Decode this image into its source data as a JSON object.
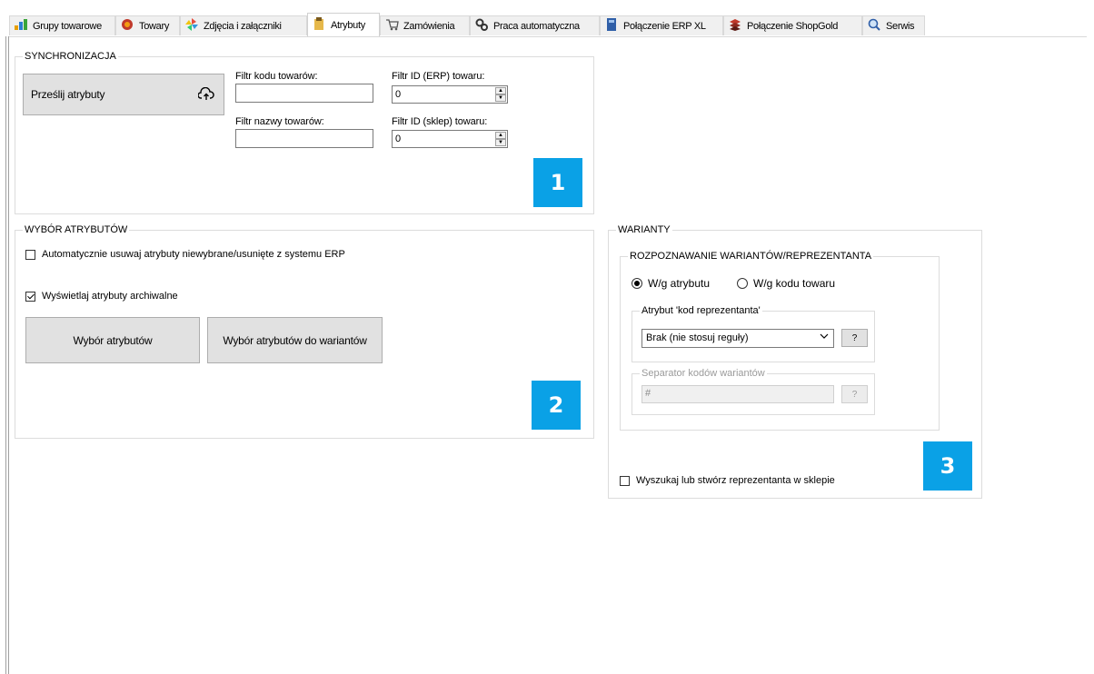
{
  "tabs": [
    {
      "label": "Grupy towarowe",
      "icon": "group-icon"
    },
    {
      "label": "Towary",
      "icon": "products-icon"
    },
    {
      "label": "Zdjęcia i załączniki",
      "icon": "pinwheel-icon"
    },
    {
      "label": "Atrybuty",
      "icon": "clipboard-icon"
    },
    {
      "label": "Zamówienia",
      "icon": "cart-icon"
    },
    {
      "label": "Praca automatyczna",
      "icon": "gears-icon"
    },
    {
      "label": "Połączenie ERP XL",
      "icon": "book-icon"
    },
    {
      "label": "Połączenie ShopGold",
      "icon": "layers-icon"
    },
    {
      "label": "Serwis",
      "icon": "magnifier-icon"
    }
  ],
  "active_tab": "Atrybuty",
  "sync": {
    "legend": "SYNCHRONIZACJA",
    "send_button": "Prześlij atrybuty",
    "code_filter_label": "Filtr kodu towarów:",
    "code_filter_value": "",
    "name_filter_label": "Filtr nazwy towarów:",
    "name_filter_value": "",
    "erp_id_label": "Filtr ID (ERP) towaru:",
    "erp_id_value": "0",
    "shop_id_label": "Filtr ID (sklep) towaru:",
    "shop_id_value": "0",
    "badge": "1"
  },
  "attributes": {
    "legend": "WYBÓR ATRYBUTÓW",
    "auto_remove_label": "Automatycznie usuwaj atrybuty niewybrane/usunięte z systemu ERP",
    "auto_remove_checked": false,
    "show_archived_label": "Wyświetlaj atrybuty archiwalne",
    "show_archived_checked": true,
    "select_button": "Wybór atrybutów",
    "select_variants_button": "Wybór atrybutów do wariantów",
    "badge": "2"
  },
  "variants": {
    "legend": "WARIANTY",
    "recognition_legend": "ROZPOZNAWANIE WARIANTÓW/REPREZENTANTA",
    "radio_by_attribute": "W/g atrybutu",
    "radio_by_code": "W/g kodu towaru",
    "selected_radio": "W/g atrybutu",
    "rep_code_legend": "Atrybut 'kod reprezentanta'",
    "rep_code_value": "Brak (nie stosuj reguły)",
    "help_label": "?",
    "separator_legend": "Separator kodów wariantów",
    "separator_value": "#",
    "search_create_label": "Wyszukaj lub stwórz reprezentanta w sklepie",
    "search_create_checked": false,
    "badge": "3"
  },
  "colors": {
    "badge": "#0aa1e6",
    "button_bg": "#e1e1e1",
    "border": "#dcdcdc"
  }
}
